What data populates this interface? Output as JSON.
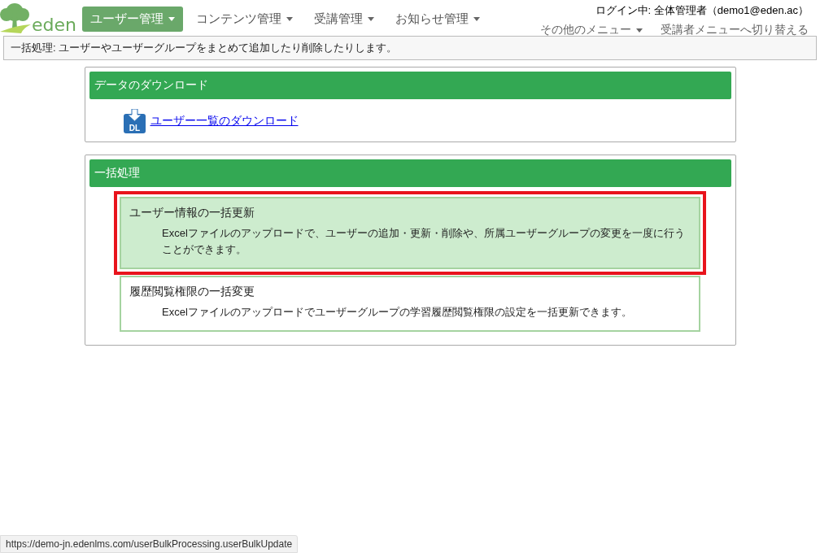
{
  "logo": {
    "text": "eden"
  },
  "nav": [
    {
      "label": "ユーザー管理",
      "selected": true
    },
    {
      "label": "コンテンツ管理",
      "selected": false
    },
    {
      "label": "受講管理",
      "selected": false
    },
    {
      "label": "お知らせ管理",
      "selected": false
    }
  ],
  "login": "ログイン中: 全体管理者（demo1@eden.ac）",
  "other_menu": "その他のメニュー",
  "switch_link": "受講者メニューへ切り替える",
  "info_bar": "一括処理: ユーザーやユーザーグループをまとめて追加したり削除したりします。",
  "download_panel": {
    "title": "データのダウンロード",
    "link": "ユーザー一覧のダウンロード",
    "icon_text": "DL"
  },
  "bulk_panel": {
    "title": "一括処理",
    "items": [
      {
        "title": "ユーザー情報の一括更新",
        "description": "Excelファイルのアップロードで、ユーザーの追加・更新・削除や、所属ユーザーグループの変更を一度に行うことができます。",
        "selected": true
      },
      {
        "title": "履歴閲覧権限の一括変更",
        "description": "Excelファイルのアップロードでユーザーグループの学習履歴閲覧権限の設定を一括更新できます。",
        "selected": false
      }
    ]
  },
  "status_bar": "https://demo-jn.edenlms.com/userBulkProcessing.userBulkUpdate"
}
